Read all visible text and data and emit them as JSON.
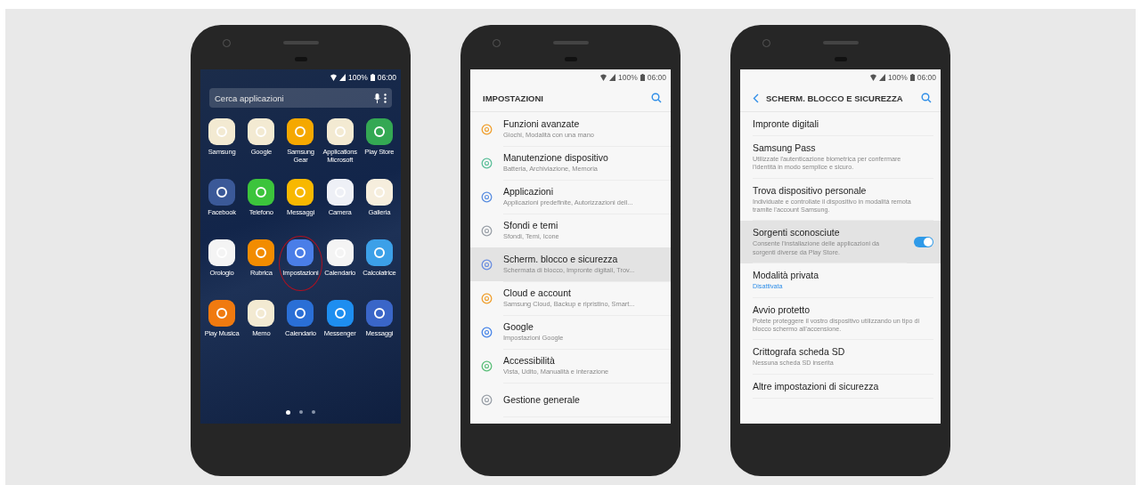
{
  "phones": [
    {
      "kind": "home",
      "status": {
        "battery": "100%",
        "time": "06:00"
      },
      "search": {
        "placeholder": "Cerca applicazioni"
      },
      "apps": [
        {
          "label": "Samsung",
          "color": "#f3ead2",
          "highlighted": false
        },
        {
          "label": "Google",
          "color": "#f3ead2",
          "highlighted": false
        },
        {
          "label": "Samsung Gear",
          "color": "#f5a800",
          "highlighted": false
        },
        {
          "label": "Applications Microsoft",
          "color": "#f3ead2",
          "highlighted": false
        },
        {
          "label": "Play Store",
          "color": "#34a853",
          "highlighted": false
        },
        {
          "label": "Facebook",
          "color": "#3b5998",
          "highlighted": false
        },
        {
          "label": "Telefono",
          "color": "#3cc43c",
          "highlighted": false
        },
        {
          "label": "Messaggi",
          "color": "#f8b800",
          "highlighted": false
        },
        {
          "label": "Camera",
          "color": "#eef0f6",
          "highlighted": false
        },
        {
          "label": "Galleria",
          "color": "#f6eedd",
          "highlighted": false
        },
        {
          "label": "Orologio",
          "color": "#f4f4f4",
          "highlighted": false
        },
        {
          "label": "Rubrica",
          "color": "#f28c00",
          "highlighted": false
        },
        {
          "label": "Impostazioni",
          "color": "#4a7ee8",
          "highlighted": true
        },
        {
          "label": "Calendario",
          "color": "#f4f4f4",
          "highlighted": false
        },
        {
          "label": "Calcolatrice",
          "color": "#3ca0e8",
          "highlighted": false
        },
        {
          "label": "Play Musica",
          "color": "#f07a10",
          "highlighted": false
        },
        {
          "label": "Memo",
          "color": "#f3ead2",
          "highlighted": false
        },
        {
          "label": "Calendario",
          "color": "#2a6fd6",
          "highlighted": false
        },
        {
          "label": "Messenger",
          "color": "#1e8ef0",
          "highlighted": false
        },
        {
          "label": "Messaggi",
          "color": "#3a66c8",
          "highlighted": false
        }
      ],
      "page_dots": [
        {
          "selected": true
        },
        {
          "selected": false
        },
        {
          "selected": false
        }
      ]
    },
    {
      "kind": "settings",
      "status": {
        "battery": "100%",
        "time": "06:00"
      },
      "title": "IMPOSTAZIONI",
      "items": [
        {
          "title": "Funzioni avanzate",
          "subtitle": "Giochi, Modalità con una mano",
          "color": "#f0a030",
          "selected": false
        },
        {
          "title": "Manutenzione dispositivo",
          "subtitle": "Batteria, Archiviazione, Memoria",
          "color": "#5cbf9a",
          "selected": false
        },
        {
          "title": "Applicazioni",
          "subtitle": "Applicazioni predefinite, Autorizzazioni dell...",
          "color": "#5a8ee0",
          "selected": false
        },
        {
          "title": "Sfondi e temi",
          "subtitle": "Sfondi, Temi, Icone",
          "color": "#9aa0a8",
          "selected": false
        },
        {
          "title": "Scherm. blocco e sicurezza",
          "subtitle": "Schermata di blocco, Impronte digitali, Trov...",
          "color": "#6a8ee0",
          "selected": true
        },
        {
          "title": "Cloud e account",
          "subtitle": "Samsung Cloud, Backup e ripristino, Smart...",
          "color": "#f0a030",
          "selected": false
        },
        {
          "title": "Google",
          "subtitle": "Impostazioni Google",
          "color": "#4a86e8",
          "selected": false
        },
        {
          "title": "Accessibilità",
          "subtitle": "Vista, Udito, Manualità e interazione",
          "color": "#5cbf7a",
          "selected": false
        },
        {
          "title": "Gestione generale",
          "color": "#9aa0a8",
          "selected": false
        }
      ]
    },
    {
      "kind": "detail",
      "status": {
        "battery": "100%",
        "time": "06:00"
      },
      "title": "SCHERM. BLOCCO E SICUREZZA",
      "items": [
        {
          "kind": "plain",
          "title": "Impronte digitali",
          "selected": false
        },
        {
          "kind": "plain",
          "title": "Samsung Pass",
          "subtitle": "Utilizzate l'autenticazione biometrica per confermare l'identità in modo semplice e sicuro.",
          "selected": false
        },
        {
          "kind": "plain",
          "title": "Trova dispositivo personale",
          "subtitle": "Individuate e controllate il dispositivo in modalità remota tramite l'account Samsung.",
          "selected": false
        },
        {
          "kind": "toggle",
          "title": "Sorgenti sconosciute",
          "subtitle": "Consente l'installazione delle applicazioni da sorgenti diverse da Play Store.",
          "on": true,
          "selected": true
        },
        {
          "kind": "status",
          "title": "Modalità privata",
          "subtitle": "Disattivata",
          "selected": false
        },
        {
          "kind": "plain",
          "title": "Avvio protetto",
          "subtitle": "Potete proteggere il vostro dispositivo utilizzando un tipo di blocco schermo all'accensione.",
          "selected": false
        },
        {
          "kind": "plain",
          "title": "Crittografa scheda SD",
          "subtitle": "Nessuna scheda SD inserita",
          "selected": false
        },
        {
          "kind": "plain",
          "title": "Altre impostazioni di sicurezza",
          "selected": false
        }
      ]
    }
  ]
}
